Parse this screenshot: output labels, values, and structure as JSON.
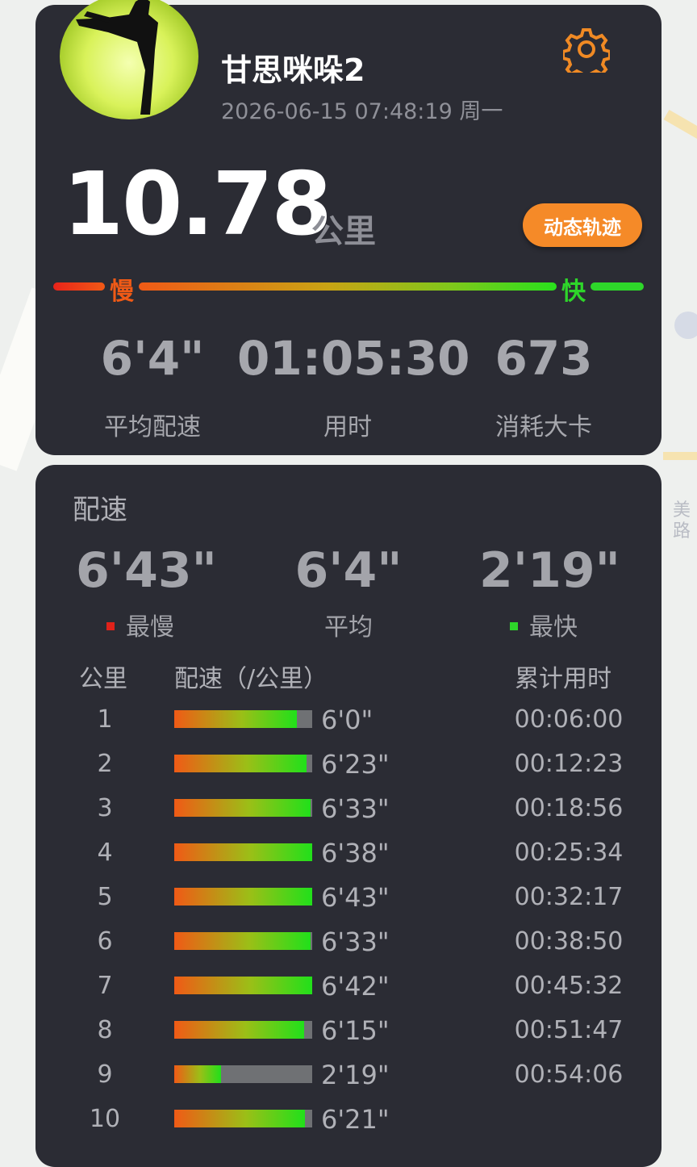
{
  "profile": {
    "username": "甘思咪哚2",
    "datetime": "2026-06-15 07:48:19 周一"
  },
  "summary": {
    "distance": "10.78",
    "distance_unit": "公里",
    "track_button": "动态轨迹",
    "speed_slow_label": "慢",
    "speed_fast_label": "快",
    "avg_pace": "6'4\"",
    "avg_pace_label": "平均配速",
    "duration": "01:05:30",
    "duration_label": "用时",
    "calories": "673",
    "calories_label": "消耗大卡"
  },
  "pace_section": {
    "title": "配速",
    "slowest": "6'43\"",
    "slowest_label": "最慢",
    "average": "6'4\"",
    "average_label": "平均",
    "fastest": "2'19\"",
    "fastest_label": "最快",
    "col_km": "公里",
    "col_pace": "配速（/公里）",
    "col_cumulative": "累计用时",
    "slow_color": "#e0221a",
    "fast_color": "#2ed62a",
    "rows": [
      {
        "km": "1",
        "pace": "6'0\"",
        "cumulative": "00:06:00",
        "fill": 0.89
      },
      {
        "km": "2",
        "pace": "6'23\"",
        "cumulative": "00:12:23",
        "fill": 0.96
      },
      {
        "km": "3",
        "pace": "6'33\"",
        "cumulative": "00:18:56",
        "fill": 0.99
      },
      {
        "km": "4",
        "pace": "6'38\"",
        "cumulative": "00:25:34",
        "fill": 1.0
      },
      {
        "km": "5",
        "pace": "6'43\"",
        "cumulative": "00:32:17",
        "fill": 1.0
      },
      {
        "km": "6",
        "pace": "6'33\"",
        "cumulative": "00:38:50",
        "fill": 0.99
      },
      {
        "km": "7",
        "pace": "6'42\"",
        "cumulative": "00:45:32",
        "fill": 1.0
      },
      {
        "km": "8",
        "pace": "6'15\"",
        "cumulative": "00:51:47",
        "fill": 0.94
      },
      {
        "km": "9",
        "pace": "2'19\"",
        "cumulative": "00:54:06",
        "fill": 0.34
      },
      {
        "km": "10",
        "pace": "6'21\"",
        "cumulative": "",
        "fill": 0.95
      }
    ]
  },
  "map": {
    "label_1": "美",
    "label_2": "路"
  }
}
